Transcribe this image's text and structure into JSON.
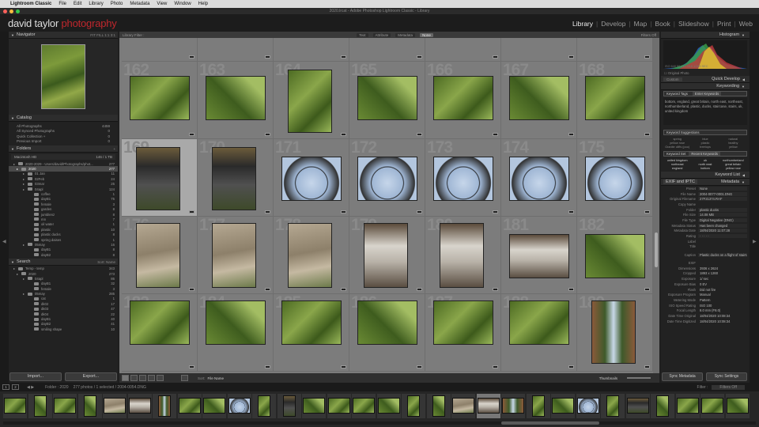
{
  "menu": {
    "apple": "",
    "app": "Lightroom Classic",
    "items": [
      "File",
      "Edit",
      "Library",
      "Photo",
      "Metadata",
      "View",
      "Window",
      "Help"
    ]
  },
  "window_title": "2020.lrcat - Adobe Photoshop Lightroom Classic - Library",
  "identity": {
    "name": "david taylor",
    "brand": "photography"
  },
  "modules": [
    "Library",
    "Develop",
    "Map",
    "Book",
    "Slideshow",
    "Print",
    "Web"
  ],
  "navigator": {
    "title": "Navigator",
    "zoom": "FIT   FILL   1:1   3:1"
  },
  "catalog": {
    "title": "Catalog",
    "items": [
      {
        "label": "All Photographs",
        "count": "4459"
      },
      {
        "label": "All Synced Photographs",
        "count": "0"
      },
      {
        "label": "Quick Collection +",
        "count": "0"
      },
      {
        "label": "Previous Import",
        "count": "0"
      }
    ]
  },
  "folders": {
    "title": "Folders",
    "volume": "Macintosh HD",
    "volume_info": "146 / 1 TB",
    "items": [
      {
        "label": "2020-2029 - Users/david/Photographs/phot...",
        "count": "277",
        "indent": 6
      },
      {
        "label": "2020",
        "count": "277",
        "indent": 10,
        "selected": true
      },
      {
        "label": "01 Jan",
        "count": "11",
        "indent": 18
      },
      {
        "label": "02Feb",
        "count": "24",
        "indent": 18
      },
      {
        "label": "03mar",
        "count": "25",
        "indent": 18
      },
      {
        "label": "04apl",
        "count": "124",
        "indent": 18
      },
      {
        "label": "coffee",
        "count": "1",
        "indent": 26
      },
      {
        "label": "dayB1",
        "count": "75",
        "indent": 26
      },
      {
        "label": "female",
        "count": "3",
        "indent": 26
      },
      {
        "label": "garden",
        "count": "8",
        "indent": 26
      },
      {
        "label": "jumblenz",
        "count": "8",
        "indent": 26
      },
      {
        "label": "mn",
        "count": "7",
        "indent": 26
      },
      {
        "label": "oil water",
        "count": "1",
        "indent": 26
      },
      {
        "label": "plastic",
        "count": "10",
        "indent": 26
      },
      {
        "label": "plastic ducks",
        "count": "8",
        "indent": 26
      },
      {
        "label": "spring daises",
        "count": "1",
        "indent": 26
      },
      {
        "label": "05may",
        "count": "16",
        "indent": 18
      },
      {
        "label": "dayB1",
        "count": "8",
        "indent": 26
      },
      {
        "label": "dayB2",
        "count": "8",
        "indent": 26
      }
    ]
  },
  "search": {
    "title": "Search",
    "info": "Sort: Name",
    "items": [
      {
        "label": "Temp - temp",
        "count": "343",
        "indent": 6
      },
      {
        "label": "2020",
        "count": "273",
        "indent": 10
      },
      {
        "label": "04apl",
        "count": "86",
        "indent": 18
      },
      {
        "label": "dayB1",
        "count": "32",
        "indent": 26
      },
      {
        "label": "female",
        "count": "3",
        "indent": 26
      },
      {
        "label": "05may",
        "count": "285",
        "indent": 18
      },
      {
        "label": "cat",
        "count": "1",
        "indent": 26
      },
      {
        "label": "dk02",
        "count": "17",
        "indent": 26
      },
      {
        "label": "dk03",
        "count": "47",
        "indent": 26
      },
      {
        "label": "dk04",
        "count": "22",
        "indent": 26
      },
      {
        "label": "dayB1",
        "count": "40",
        "indent": 26
      },
      {
        "label": "dayB2",
        "count": "41",
        "indent": 26
      },
      {
        "label": "smiling shape",
        "count": "10",
        "indent": 26
      }
    ]
  },
  "buttons": {
    "import": "Import...",
    "export": "Export...",
    "sync_metadata": "Sync Metadata",
    "sync_settings": "Sync Settings"
  },
  "library_filter": {
    "label": "Library Filter :",
    "options": [
      "Text",
      "Attribute",
      "Metadata",
      "None"
    ],
    "active": "None",
    "custom": "Filters Off"
  },
  "grid": {
    "rows": [
      {
        "start": 157,
        "type": "partial"
      },
      {
        "start": 162,
        "type": "plants"
      },
      {
        "start": 169,
        "type": "mixed"
      },
      {
        "start": 176,
        "type": "statues"
      },
      {
        "start": 183,
        "type": "plants"
      }
    ]
  },
  "toolbar": {
    "sort_label": "Sort:",
    "sort_value": "File Name",
    "thumbnails": "Thumbnails"
  },
  "filmstrip_bar": {
    "pages": [
      "1",
      "2"
    ],
    "folder": "Folder : 2020",
    "count": "277 photos / 1 selected / 2004-0054.DNG",
    "filter_label": "Filter :",
    "filter_value": "Filters Off"
  },
  "histogram": {
    "title": "Histogram",
    "info": "ISO 640   50 mm   f/5.6   1/160 SEC",
    "original_photo": "Original Photo"
  },
  "quick_develop": {
    "title": "Quick Develop",
    "preset": "Custom"
  },
  "keywording": {
    "title": "Keywording",
    "tags_label": "Keyword Tags",
    "tags_mode": "Enter Keywords",
    "keywords": "bottom, england, great britain, north east, northeast, northumberland, plastic, ducks, staircase, stairs, uk, united kingdom",
    "suggestions_label": "Keyword Suggestions",
    "suggestions": [
      "spring",
      "blue",
      "natural",
      "yellow rose",
      "plastic",
      "healthy",
      "Granite cliffs (poo)",
      "treetops",
      "yellow"
    ],
    "set_label": "Keyword Set",
    "set_value": "Recent Keywords",
    "set": [
      "united kingdom",
      "uk",
      "northumberland",
      "northeast",
      "north east",
      "great britain",
      "england",
      "bottom",
      "yellow rose"
    ]
  },
  "keyword_list": {
    "title": "Keyword List"
  },
  "metadata": {
    "title": "Metadata",
    "preset_label": "Preset",
    "preset": "None",
    "view": "EXIF and IPTC",
    "rows": [
      {
        "k": "File Name",
        "v": "2004-0077-0001.DNG"
      },
      {
        "k": "Original Filename",
        "v": "27F21374.RAF"
      },
      {
        "k": "Copy Name",
        "v": ""
      },
      {
        "k": "Folder",
        "v": "plastic ducks"
      },
      {
        "k": "File Size",
        "v": "14.08 MB"
      },
      {
        "k": "File Type",
        "v": "Digital Negative (DNG)"
      },
      {
        "k": "Metadata Status",
        "v": "Has been changed"
      },
      {
        "k": "Metadata Date",
        "v": "18/04/2020 11:07:28"
      },
      {
        "k": "Rating",
        "v": "·  ·  ·  ·  ·"
      },
      {
        "k": "Label",
        "v": ""
      },
      {
        "k": "Title",
        "v": ""
      },
      {
        "k": "Caption",
        "v": "Plastic ducks on a flight of stairs"
      },
      {
        "k": "EXIF",
        "v": ""
      },
      {
        "k": "Dimensions",
        "v": "3936 x 2624"
      },
      {
        "k": "Cropped",
        "v": "1893 x 1260"
      },
      {
        "k": "Exposure",
        "v": "1/ sec"
      },
      {
        "k": "Exposure Bias",
        "v": "0 EV"
      },
      {
        "k": "Flash",
        "v": "Did not fire"
      },
      {
        "k": "Exposure Program",
        "v": "Manual"
      },
      {
        "k": "Metering Mode",
        "v": "Pattern"
      },
      {
        "k": "ISO Speed Rating",
        "v": "ISO 100"
      },
      {
        "k": "Focal Length",
        "v": "8.0 mm (F8.0)"
      },
      {
        "k": "Date Time Original",
        "v": "18/04/2020 10:08:34"
      },
      {
        "k": "Date Time Digitized",
        "v": "18/04/2020 10:08:34"
      }
    ]
  }
}
